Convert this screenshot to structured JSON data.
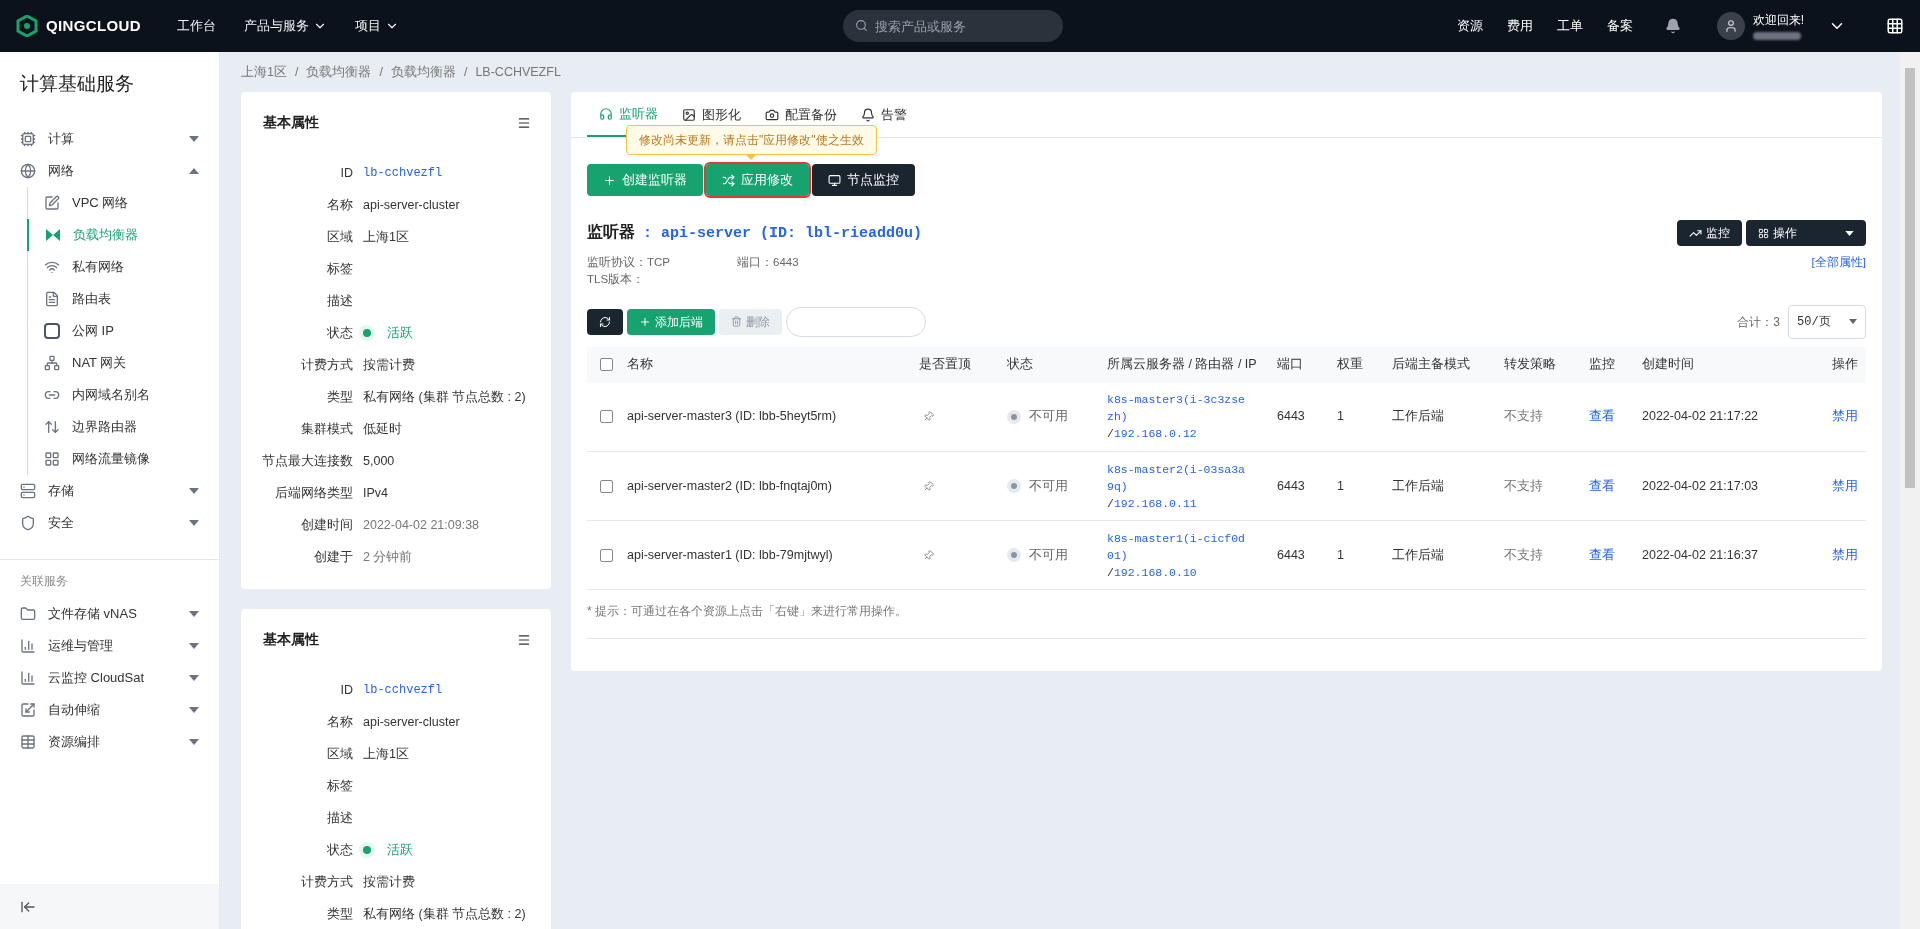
{
  "topbar": {
    "logo": "QINGCLOUD",
    "nav": [
      {
        "label": "工作台",
        "caret": false
      },
      {
        "label": "产品与服务",
        "caret": true
      },
      {
        "label": "项目",
        "caret": true
      }
    ],
    "search": {
      "placeholder": "搜索产品或服务"
    },
    "links": [
      "资源",
      "费用",
      "工单",
      "备案"
    ],
    "greeting": "欢迎回来!"
  },
  "breadcrumb": {
    "separator": "/",
    "items": [
      "上海1区",
      "负载均衡器",
      "负载均衡器",
      "LB-CCHVEZFL"
    ]
  },
  "sidebar": {
    "title": "计算基础服务",
    "groups": [
      {
        "label": "计算",
        "expanded": false
      },
      {
        "label": "网络",
        "expanded": true,
        "children": [
          {
            "label": "VPC 网络",
            "selected": false
          },
          {
            "label": "负载均衡器",
            "selected": true
          },
          {
            "label": "私有网络",
            "selected": false
          },
          {
            "label": "路由表",
            "selected": false
          },
          {
            "label": "公网 IP",
            "selected": false
          },
          {
            "label": "NAT 网关",
            "selected": false
          },
          {
            "label": "内网域名别名",
            "selected": false
          },
          {
            "label": "边界路由器",
            "selected": false
          },
          {
            "label": "网络流量镜像",
            "selected": false
          }
        ]
      },
      {
        "label": "存储",
        "expanded": false
      },
      {
        "label": "安全",
        "expanded": false
      }
    ],
    "related_title": "关联服务",
    "related": [
      {
        "label": "文件存储 vNAS",
        "expanded": false
      },
      {
        "label": "运维与管理",
        "expanded": false
      },
      {
        "label": "云监控 CloudSat",
        "expanded": false
      },
      {
        "label": "自动伸缩",
        "expanded": false
      },
      {
        "label": "资源编排",
        "expanded": false
      }
    ]
  },
  "cards": [
    {
      "title": "基本属性",
      "fields": [
        {
          "label": "ID",
          "value": "lb-cchvezfl",
          "kind": "mono"
        },
        {
          "label": "名称",
          "value": "api-server-cluster",
          "kind": "text"
        },
        {
          "label": "区域",
          "value": "上海1区",
          "kind": "text"
        },
        {
          "label": "标签",
          "kind": "empty"
        },
        {
          "label": "描述",
          "kind": "empty"
        },
        {
          "label": "状态",
          "value": "活跃",
          "kind": "status"
        },
        {
          "label": "计费方式",
          "value": "按需计费",
          "kind": "text"
        },
        {
          "label": "类型",
          "value": "私有网络 (集群 节点总数 : 2)",
          "kind": "text"
        },
        {
          "label": "集群模式",
          "value": "低延时",
          "kind": "text"
        },
        {
          "label": "节点最大连接数",
          "value": "5,000",
          "kind": "text"
        },
        {
          "label": "后端网络类型",
          "value": "IPv4",
          "kind": "text"
        },
        {
          "label": "创建时间",
          "value": "2022-04-02 21:09:38",
          "kind": "muted"
        },
        {
          "label": "创建于",
          "value": "2 分钟前",
          "kind": "muted"
        }
      ]
    },
    {
      "title": "基本属性",
      "fields": [
        {
          "label": "ID",
          "value": "lb-cchvezfl",
          "kind": "mono"
        },
        {
          "label": "名称",
          "value": "api-server-cluster",
          "kind": "text"
        },
        {
          "label": "区域",
          "value": "上海1区",
          "kind": "text"
        },
        {
          "label": "标签",
          "kind": "empty"
        },
        {
          "label": "描述",
          "kind": "empty"
        },
        {
          "label": "状态",
          "value": "活跃",
          "kind": "status"
        },
        {
          "label": "计费方式",
          "value": "按需计费",
          "kind": "text"
        },
        {
          "label": "类型",
          "value": "私有网络 (集群 节点总数 : 2)",
          "kind": "text"
        }
      ]
    }
  ],
  "tabs": [
    {
      "label": "监听器",
      "selected": true
    },
    {
      "label": "图形化",
      "selected": false
    },
    {
      "label": "配置备份",
      "selected": false
    },
    {
      "label": "告警",
      "selected": false
    }
  ],
  "tooltip": "修改尚未更新，请点击\"应用修改\"使之生效",
  "actions": [
    {
      "label": "创建监听器",
      "kind": "primary",
      "highlighted": false
    },
    {
      "label": "应用修改",
      "kind": "primary",
      "highlighted": true
    },
    {
      "label": "节点监控",
      "kind": "secondary",
      "highlighted": false
    }
  ],
  "listener": {
    "label": "监听器",
    "name": ": api-server (ID: lbl-rieadd0u)",
    "protocol": "监听协议：TCP",
    "port": "端口：6443",
    "tls": "TLS版本：",
    "monitor_button": "监控",
    "ops_button": "操作",
    "all_attrs": "[全部属性]"
  },
  "toolbar": {
    "add": "添加后端",
    "delete": {
      "label": "删除",
      "disabled": true
    },
    "total": "合计：3",
    "page_size": "50/页"
  },
  "table": {
    "select_all_checked": false,
    "columns": [
      "名称",
      "是否置顶",
      "状态",
      "所属云服务器 / 路由器 / IP",
      "端口",
      "权重",
      "后端主备模式",
      "转发策略",
      "监控",
      "创建时间",
      "操作"
    ],
    "rows": [
      {
        "checked": false,
        "name": "api-server-master3 (ID: lbb-5heyt5rm)",
        "status": "不可用",
        "server": [
          "k8s-master3(i-3c3zse",
          "zh)"
        ],
        "separator": "/",
        "ip": "192.168.0.12",
        "port": "6443",
        "weight": "1",
        "mode": "工作后端",
        "policy": "不支持",
        "monitor": "查看",
        "created": "2022-04-02 21:17:22",
        "action": "禁用"
      },
      {
        "checked": false,
        "name": "api-server-master2 (ID: lbb-fnqtaj0m)",
        "status": "不可用",
        "server": [
          "k8s-master2(i-03sa3a",
          "9q)"
        ],
        "separator": "/",
        "ip": "192.168.0.11",
        "port": "6443",
        "weight": "1",
        "mode": "工作后端",
        "policy": "不支持",
        "monitor": "查看",
        "created": "2022-04-02 21:17:03",
        "action": "禁用"
      },
      {
        "checked": false,
        "name": "api-server-master1 (ID: lbb-79mjtwyl)",
        "status": "不可用",
        "server": [
          "k8s-master1(i-cicf0d",
          "01)"
        ],
        "separator": "/",
        "ip": "192.168.0.10",
        "port": "6443",
        "weight": "1",
        "mode": "工作后端",
        "policy": "不支持",
        "monitor": "查看",
        "created": "2022-04-02 21:16:37",
        "action": "禁用"
      }
    ]
  },
  "hint": "* 提示：可通过在各个资源上点击「右键」来进行常用操作。"
}
